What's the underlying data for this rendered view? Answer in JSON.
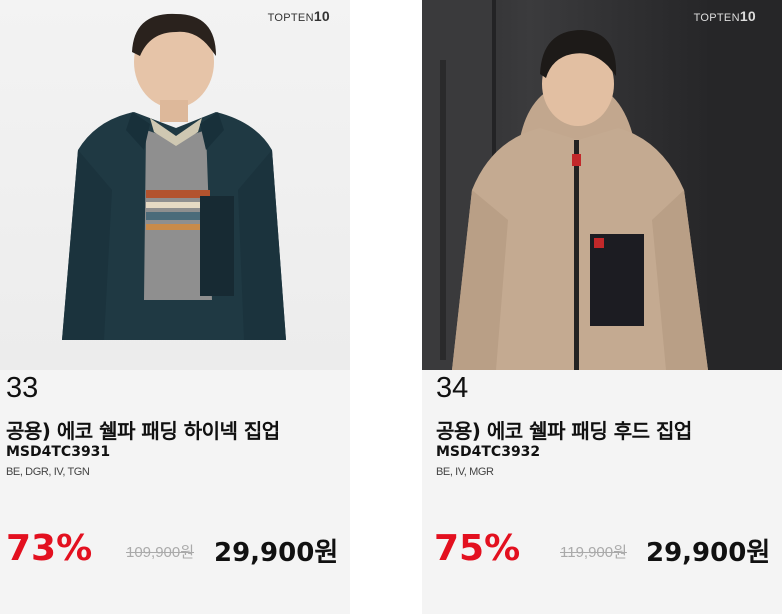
{
  "products": [
    {
      "brand": "TOPTEN",
      "brand_num": "10",
      "rank": "33",
      "name": "공용) 에코 쉘파 패딩 하이넥 집업",
      "code": "MSD4TC3931",
      "colors": "BE, DGR, IV, TGN",
      "discount": "73%",
      "original_price": "109,900원",
      "price": "29,900원"
    },
    {
      "brand": "TOPTEN",
      "brand_num": "10",
      "rank": "34",
      "name": "공용) 에코 쉘파 패딩 후드 집업",
      "code": "MSD4TC3932",
      "colors": "BE, IV, MGR",
      "discount": "75%",
      "original_price": "119,900원",
      "price": "29,900원"
    }
  ],
  "colors": {
    "discount_red": "#e3101f",
    "card_bg": "#f4f4f4"
  }
}
